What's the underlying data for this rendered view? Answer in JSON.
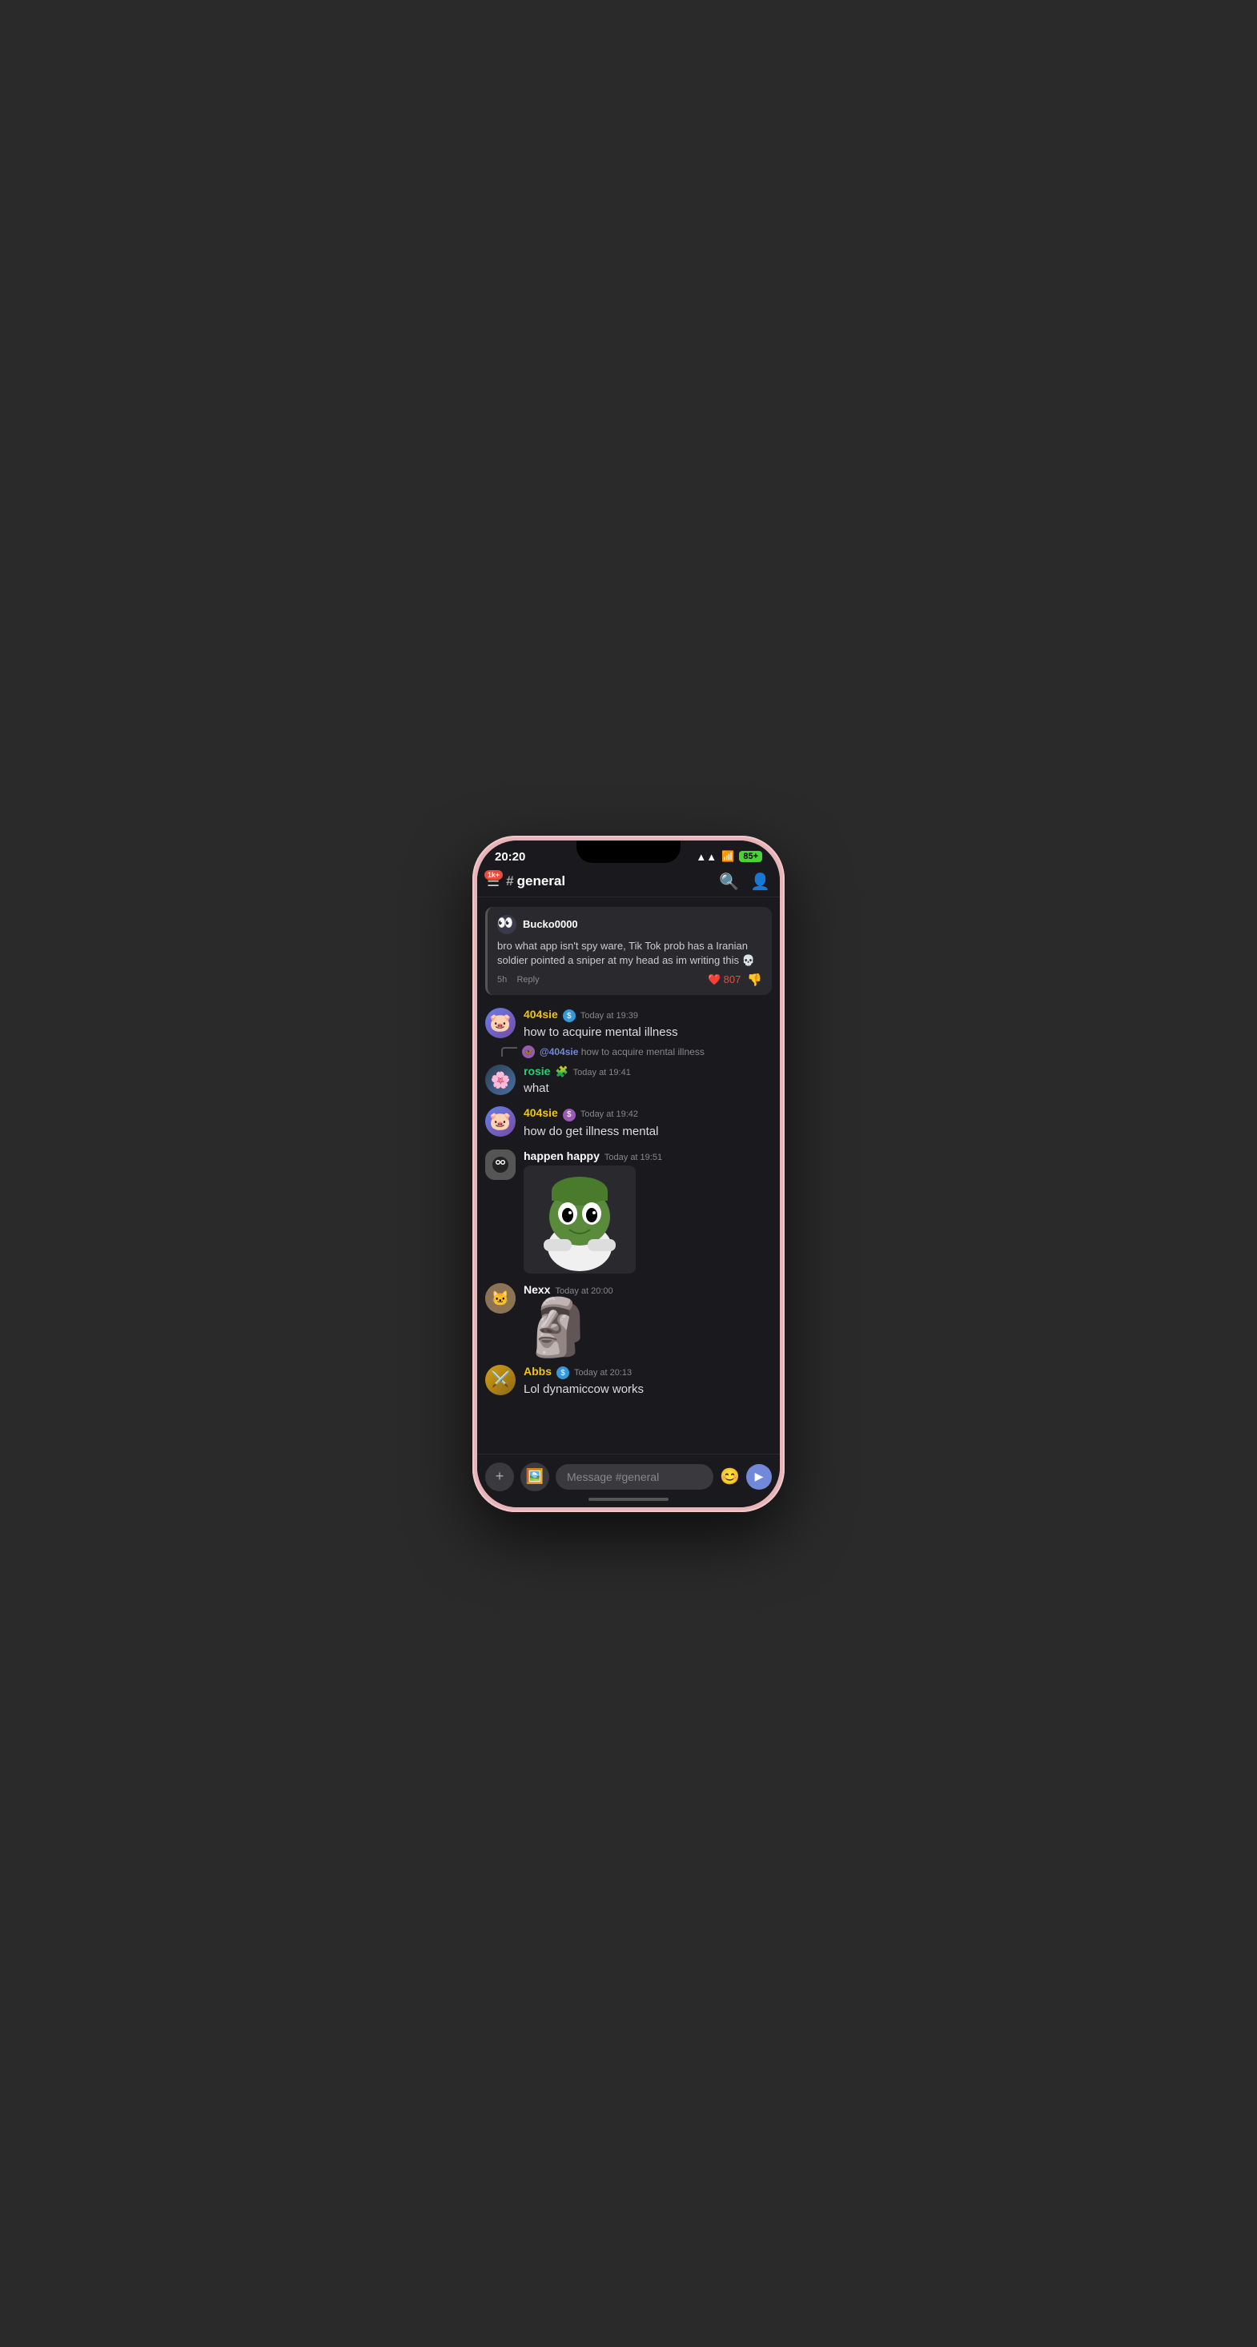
{
  "phone": {
    "time": "20:20",
    "signal": "▲▲",
    "wifi": "wifi",
    "battery": "85+"
  },
  "header": {
    "badge": "1k+",
    "channel": "general",
    "hash": "#"
  },
  "messages": [
    {
      "id": "bucko-msg",
      "type": "reply-card",
      "username": "Bucko0000",
      "avatar_emoji": "👀",
      "text": "bro what app isn't spy ware, Tik Tok prob has a Iranian soldier pointed a sniper at my head as im writing this 💀",
      "time_ago": "5h",
      "reply_label": "Reply",
      "reaction_count": "807",
      "reaction_type": "❤️"
    },
    {
      "id": "msg-404sie-1",
      "type": "message",
      "username": "404sie",
      "username_color": "yellow",
      "badge": "$",
      "badge_color": "blue",
      "timestamp": "Today at 19:39",
      "avatar_emoji": "🐷",
      "text": "how to acquire mental illness"
    },
    {
      "id": "msg-rosie-reply",
      "type": "reply-ref",
      "reply_to_user": "@404sie",
      "reply_to_text": "how to acquire mental illness"
    },
    {
      "id": "msg-rosie",
      "type": "message",
      "username": "rosie",
      "username_color": "green",
      "badge": "🧩",
      "badge_color": null,
      "timestamp": "Today at 19:41",
      "avatar_emoji": "🌸",
      "text": "what"
    },
    {
      "id": "msg-404sie-2",
      "type": "message",
      "username": "404sie",
      "username_color": "yellow",
      "badge": "$",
      "badge_color": "purple",
      "timestamp": "Today at 19:42",
      "avatar_emoji": "🐷",
      "text": "how do get illness mental"
    },
    {
      "id": "msg-happen",
      "type": "message",
      "username": "happen happy",
      "username_color": "white",
      "badge": null,
      "timestamp": "Today at 19:51",
      "avatar_emoji": "⚫",
      "text": "",
      "has_image": true,
      "image_type": "pepe"
    },
    {
      "id": "msg-nexx",
      "type": "message",
      "username": "Nexx",
      "username_color": "white",
      "badge": null,
      "timestamp": "Today at 20:00",
      "avatar_emoji": "🐱",
      "text": "",
      "has_image": true,
      "image_type": "moai"
    },
    {
      "id": "msg-abbs",
      "type": "message",
      "username": "Abbs",
      "username_color": "yellow",
      "badge": "$",
      "badge_color": "blue",
      "timestamp": "Today at 20:13",
      "avatar_emoji": "⚔️",
      "text": "Lol dynamiccow works"
    }
  ],
  "input": {
    "placeholder": "Message #general",
    "plus_label": "+",
    "image_label": "🖼",
    "emoji_label": "😊",
    "send_label": "▶"
  }
}
